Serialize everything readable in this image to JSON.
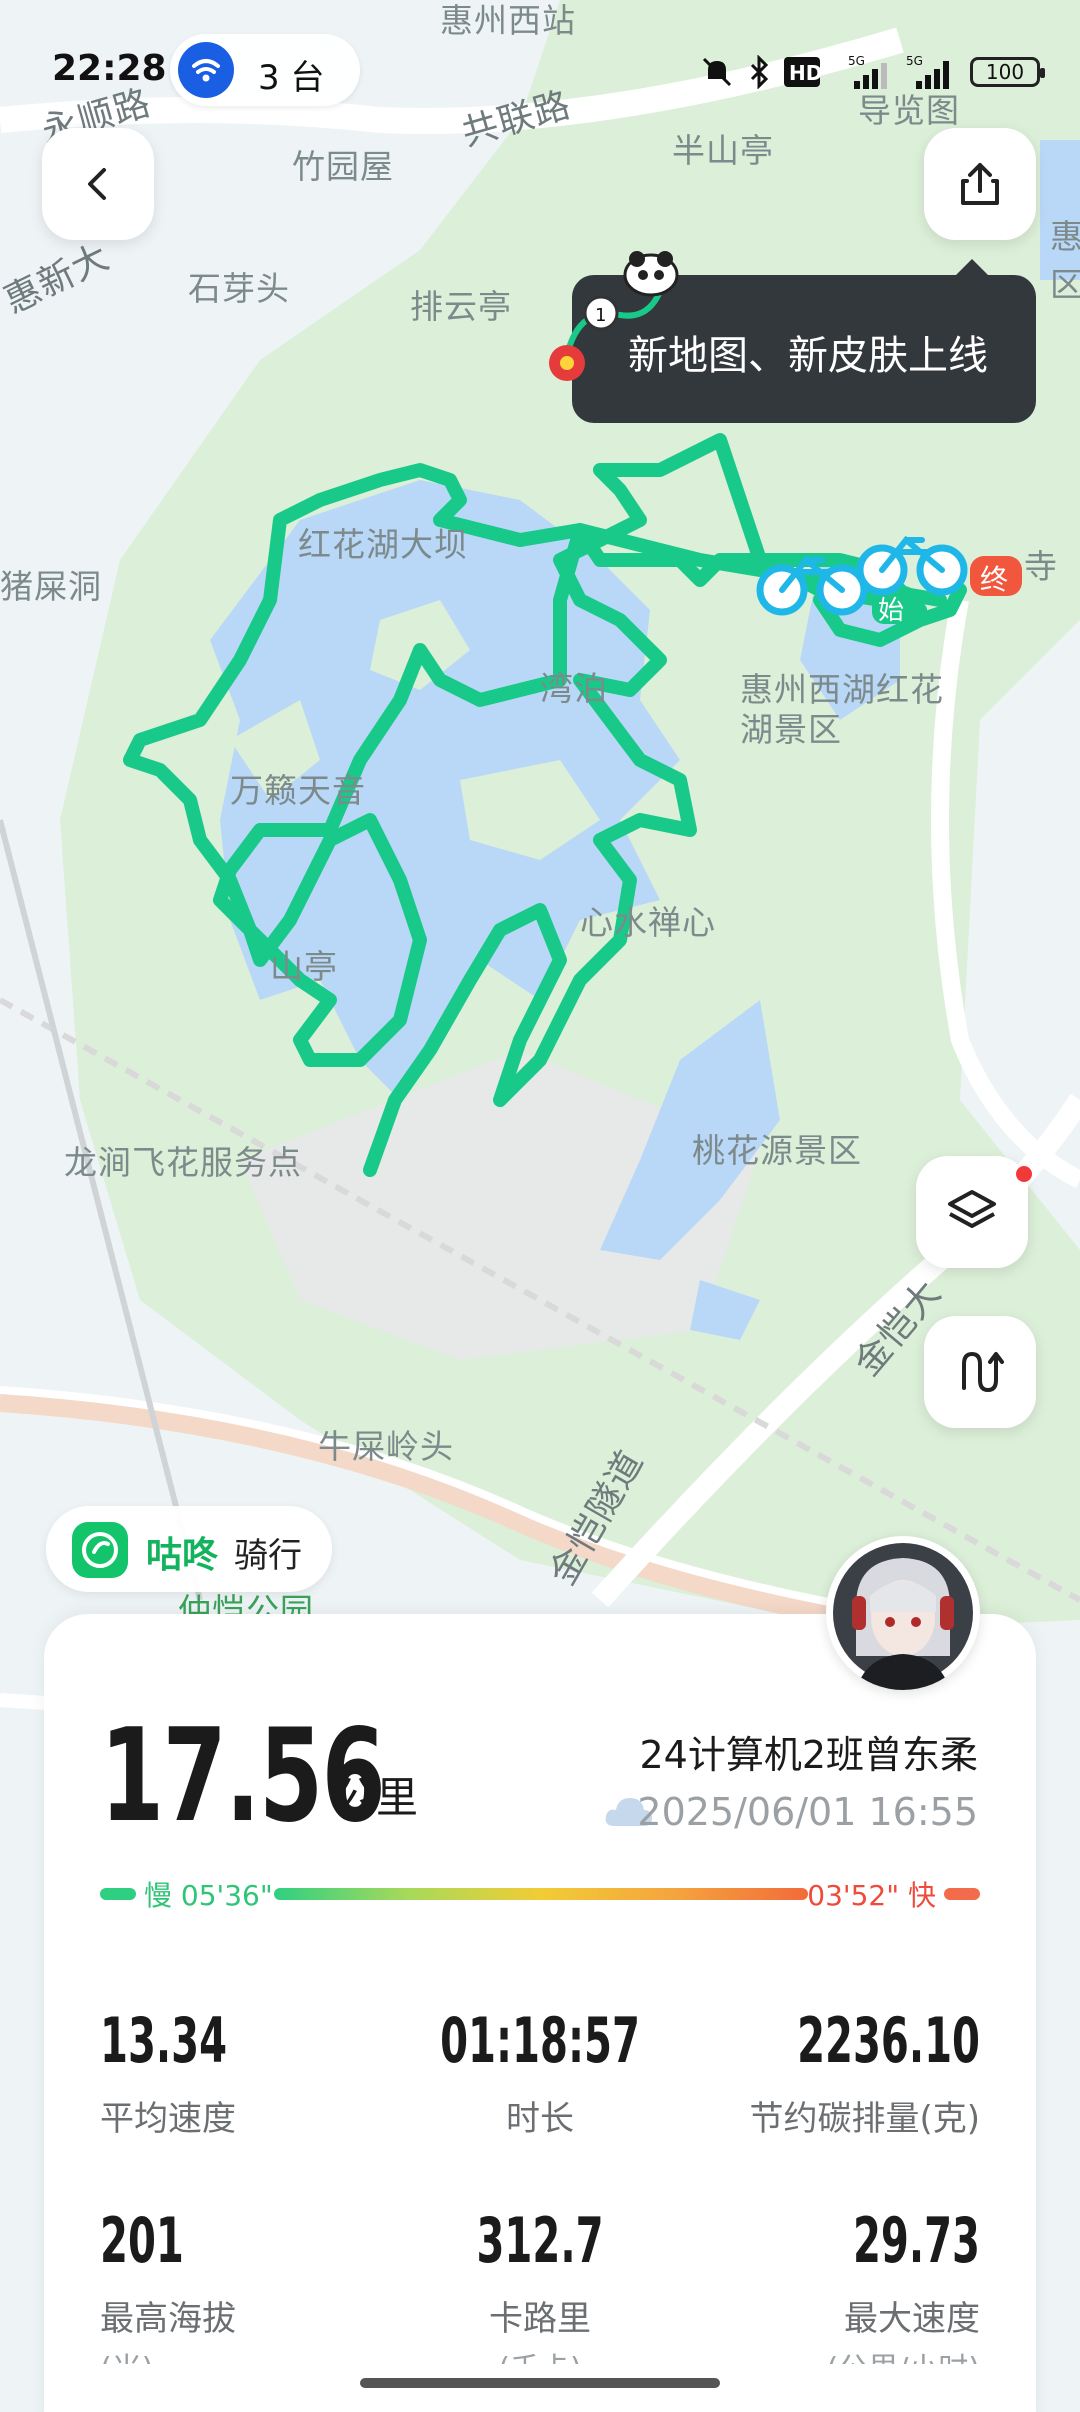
{
  "status_bar": {
    "time": "22:28",
    "hotspot_count": "3 台",
    "battery": "100",
    "icons": [
      "mute-icon",
      "bluetooth-icon",
      "hd-icon",
      "signal-5g-icon",
      "signal-5g-icon",
      "battery-icon"
    ]
  },
  "map": {
    "labels": {
      "huizhou_west": "惠州西站",
      "yongshun_rd": "永顺路",
      "gonglian_rd": "共联路",
      "daolan_tu": "导览图",
      "banshan_ting": "半山亭",
      "zhuyuan_wu": "竹园屋",
      "shiya_tou": "石芽头",
      "paiyun_ting": "排云亭",
      "huixin": "惠新大",
      "zhushi_dong": "猪屎洞",
      "honghua_hu": "红花湖大坝",
      "wanlai_tianyin": "万籁天音",
      "wanyue_bo": "湾泊",
      "water_heart": "心水禅心",
      "yunshan_ting": "山亭",
      "west_lake": "惠州西湖红花湖景区",
      "longjian": "龙涧飞花服务点",
      "taohuayuan": "桃花源景区",
      "jinkai": "金恺大",
      "niushi_ling": "牛屎岭头",
      "jinkai_tunnel": "金恺隧道",
      "zhongkai_park": "仲恺公园",
      "siyuan": "寺",
      "hui": "惠区"
    },
    "route_color": "#19c98a",
    "lake_color": "#b9d8f7",
    "park_color": "#d9efd6",
    "start_marker": "始",
    "end_marker": "终"
  },
  "buttons": {
    "back": "back-icon",
    "share": "share-icon",
    "layers": "layers-icon",
    "route": "route-icon"
  },
  "tooltip": {
    "text": "新地图、新皮肤上线"
  },
  "brand": {
    "name": "咕咚",
    "activity": "骑行"
  },
  "summary": {
    "distance": "17.56",
    "distance_unit": "公里",
    "rider": "24计算机2班曾东柔",
    "datetime": "2025/06/01 16:55",
    "pace_slow": "慢 05'36\"",
    "pace_fast": "03'52\" 快",
    "slow_color": "#2fc577",
    "fast_color": "#f04a3a"
  },
  "stats": [
    {
      "value": "13.34",
      "label": "平均速度",
      "sub": ""
    },
    {
      "value": "01:18:57",
      "label": "时长",
      "sub": ""
    },
    {
      "value": "2236.10",
      "label": "节约碳排量(克)",
      "sub": ""
    },
    {
      "value": "201",
      "label": "最高海拔",
      "sub": "(米)"
    },
    {
      "value": "312.7",
      "label": "卡路里",
      "sub": "(千卡)"
    },
    {
      "value": "29.73",
      "label": "最大速度",
      "sub": "(公里/小时)"
    }
  ]
}
